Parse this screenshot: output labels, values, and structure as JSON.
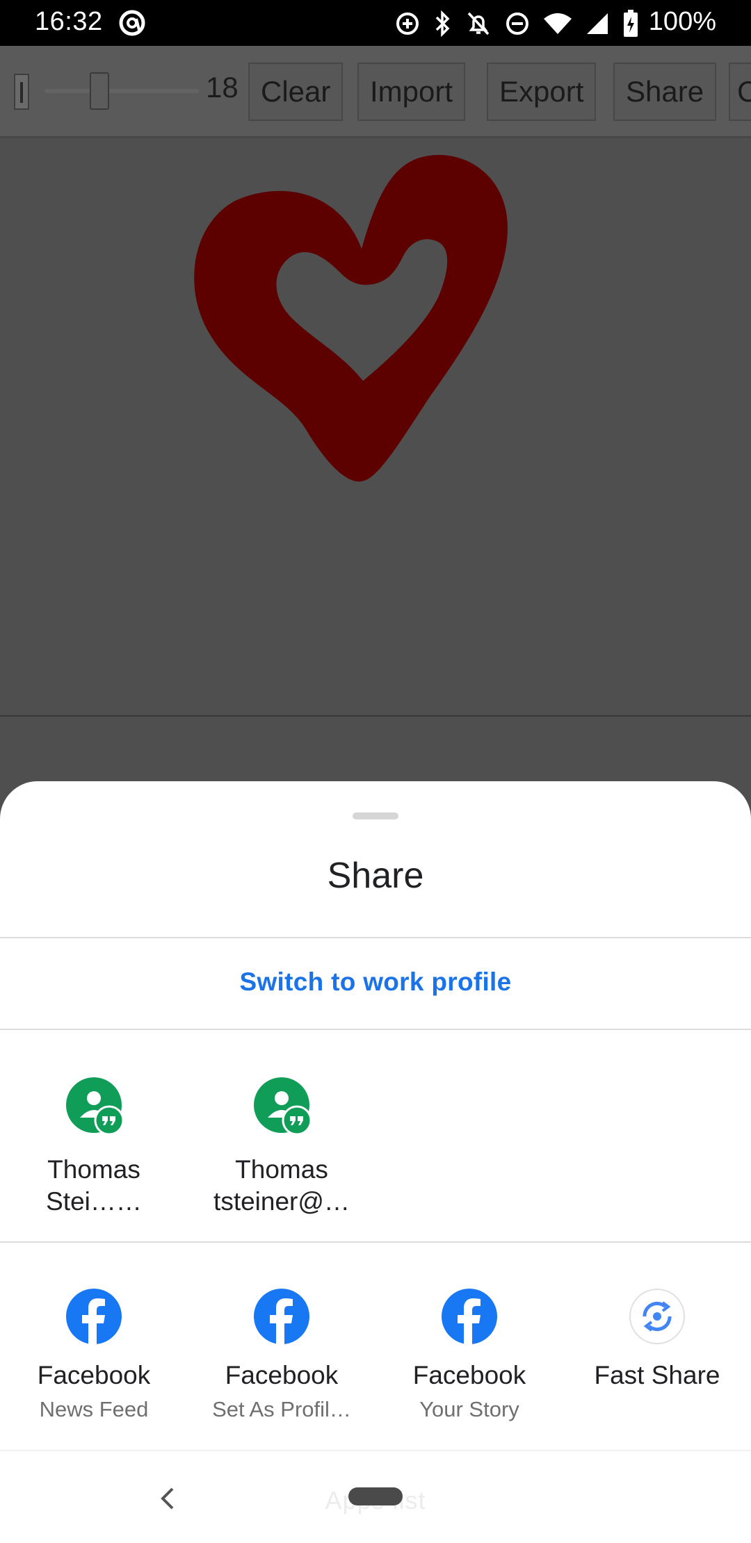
{
  "status_bar": {
    "time": "16:32",
    "battery_text": "100%",
    "icons": [
      "at-icon",
      "data-saver-icon",
      "bluetooth-icon",
      "alarm-off-icon",
      "do-not-disturb-icon",
      "wifi-icon",
      "cell-signal-icon",
      "battery-charging-icon"
    ]
  },
  "toolbar": {
    "brush_size": "18",
    "buttons": [
      "Clear",
      "Import",
      "Export",
      "Share"
    ],
    "partial_button": "C"
  },
  "canvas": {
    "drawing": "heart-drawing",
    "stroke_color": "#5c0000"
  },
  "share_sheet": {
    "title": "Share",
    "switch_profile": "Switch to work profile",
    "direct_targets": [
      {
        "icon": "hangouts-contact-icon",
        "line1": "Thomas",
        "line2": "Stei……"
      },
      {
        "icon": "hangouts-contact-icon",
        "line1": "Thomas",
        "line2": "tsteiner@…"
      }
    ],
    "app_targets": [
      {
        "icon": "facebook-icon",
        "label": "Facebook",
        "sub": "News Feed"
      },
      {
        "icon": "facebook-icon",
        "label": "Facebook",
        "sub": "Set As Profil…"
      },
      {
        "icon": "facebook-icon",
        "label": "Facebook",
        "sub": "Your Story"
      },
      {
        "icon": "fast-share-icon",
        "label": "Fast Share",
        "sub": ""
      }
    ],
    "apps_list_ghost": "Apps list"
  },
  "colors": {
    "accent_link": "#1a73e8",
    "hangouts_green": "#0f9d58",
    "facebook_blue": "#1877f2"
  }
}
